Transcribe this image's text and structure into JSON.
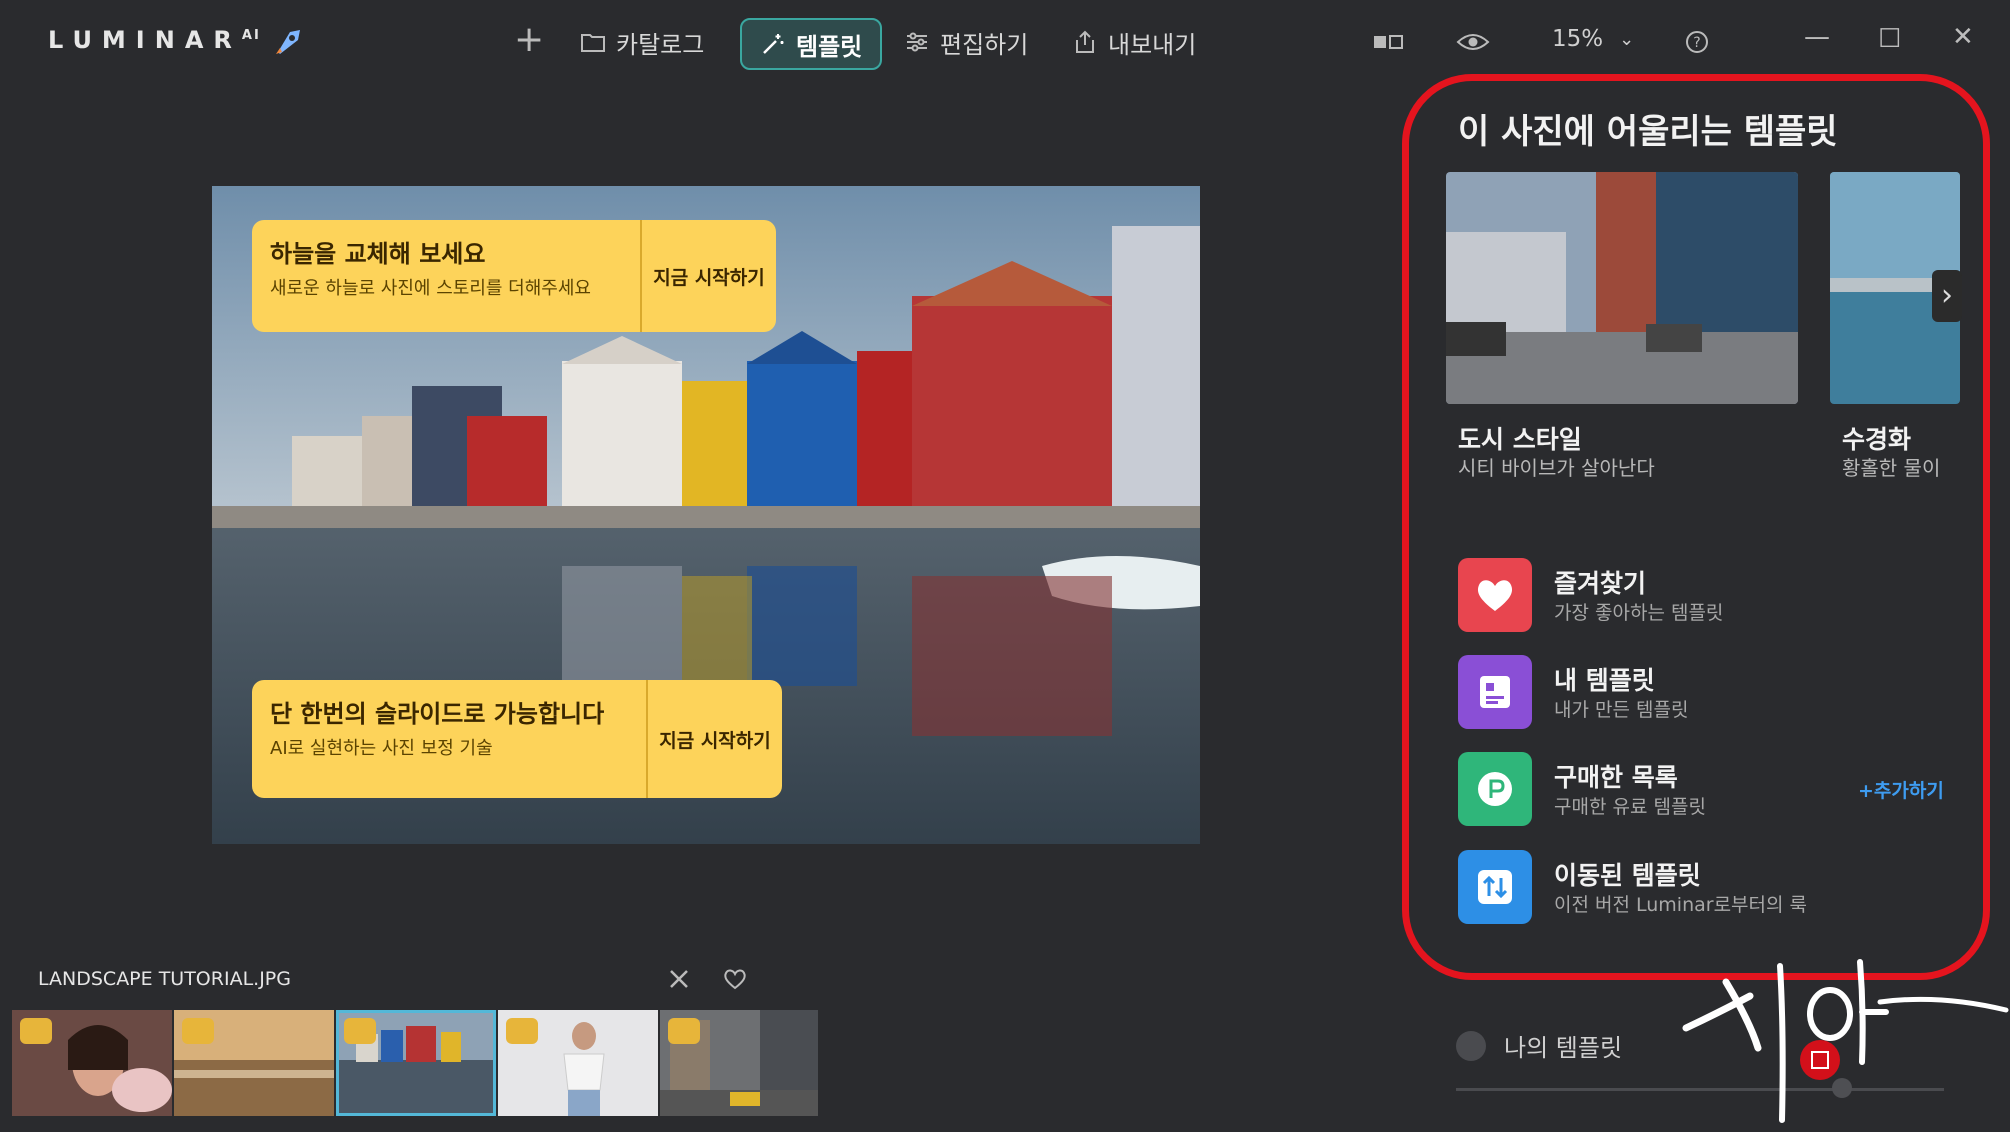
{
  "app": {
    "logo": "LUMINAR",
    "logo_sup": "AI"
  },
  "nav": {
    "catalog": "카탈로그",
    "templates": "템플릿",
    "edit": "편집하기",
    "export": "내보내기"
  },
  "toolbar": {
    "zoom": "15%"
  },
  "photo": {
    "callout_top": {
      "title": "하늘을 교체해 보세요",
      "subtitle": "새로운 하늘로 사진에 스토리를 더해주세요",
      "cta": "지금 시작하기"
    },
    "callout_bottom": {
      "title": "단 한번의 슬라이드로 가능합니다",
      "subtitle": "AI로 실현하는 사진 보정 기술",
      "cta": "지금 시작하기"
    }
  },
  "filmstrip": {
    "filename": "LANDSCAPE TUTORIAL.JPG",
    "selected_index": 2
  },
  "panel": {
    "title": "이 사진에 어울리는 템플릿",
    "cards": [
      {
        "title": "도시 스타일",
        "subtitle": "시티 바이브가 살아난다"
      },
      {
        "title": "수경화",
        "subtitle": "황홀한 물이"
      }
    ],
    "rows": [
      {
        "label": "즐겨찾기",
        "sub": "가장 좋아하는 템플릿",
        "color": "#e8454f"
      },
      {
        "label": "내 템플릿",
        "sub": "내가 만든 템플릿",
        "color": "#8a4fd6"
      },
      {
        "label": "구매한 목록",
        "sub": "구매한 유료 템플릿",
        "color": "#2fb67a"
      },
      {
        "label": "이동된 템플릿",
        "sub": "이전 버전 Luminar로부터의 룩",
        "color": "#2d8fe6"
      }
    ],
    "add_link": "+추가하기",
    "my_templates": "나의 템플릿"
  },
  "colors": {
    "highlight": "#e4141e",
    "callout": "#fdd35a",
    "accent": "#3aa7a0"
  }
}
